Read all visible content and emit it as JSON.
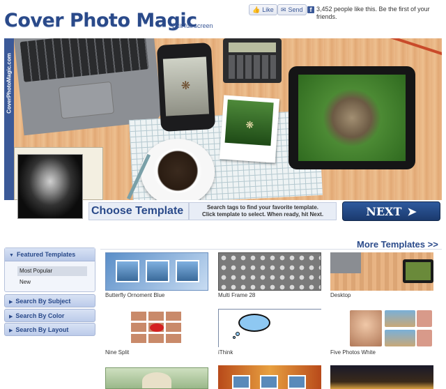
{
  "header": {
    "logo_text": "Cover Photo Magic",
    "exit_link": "Exit full screen",
    "like_label": "Like",
    "send_label": "Send",
    "facebook_social_text": "3,452 people like this. Be the first of your friends."
  },
  "banner": {
    "side_label": "CoverPhotoMagic.com"
  },
  "choose": {
    "title": "Choose Template",
    "help_line1": "Search tags to find your favorite template.",
    "help_line2": "Click template to select. When ready, hit Next.",
    "next_label": "NEXT"
  },
  "sidebar": {
    "featured_label": "Featured Templates",
    "items": [
      {
        "label": "Most Popular",
        "selected": true
      },
      {
        "label": "New",
        "selected": false
      }
    ],
    "sections": [
      {
        "label": "Search By Subject"
      },
      {
        "label": "Search By Color"
      },
      {
        "label": "Search By Layout"
      }
    ]
  },
  "more_templates": "More Templates >>",
  "templates": [
    {
      "label": "Butterfly Ornoment Blue"
    },
    {
      "label": "Multi Frame 28"
    },
    {
      "label": "Desktop"
    },
    {
      "label": "Nine Split"
    },
    {
      "label": "iThink"
    },
    {
      "label": "Five Photos White"
    }
  ],
  "icons": {
    "facebook": "facebook-f-icon",
    "like": "thumbs-up-icon",
    "send": "send-icon",
    "next_arrow": "arrow-right-icon",
    "section_triangle": "triangle-right-icon"
  },
  "colors": {
    "brand_blue": "#2a4a8a",
    "facebook_blue": "#3b5998",
    "next_button": "#1b3a6e"
  }
}
